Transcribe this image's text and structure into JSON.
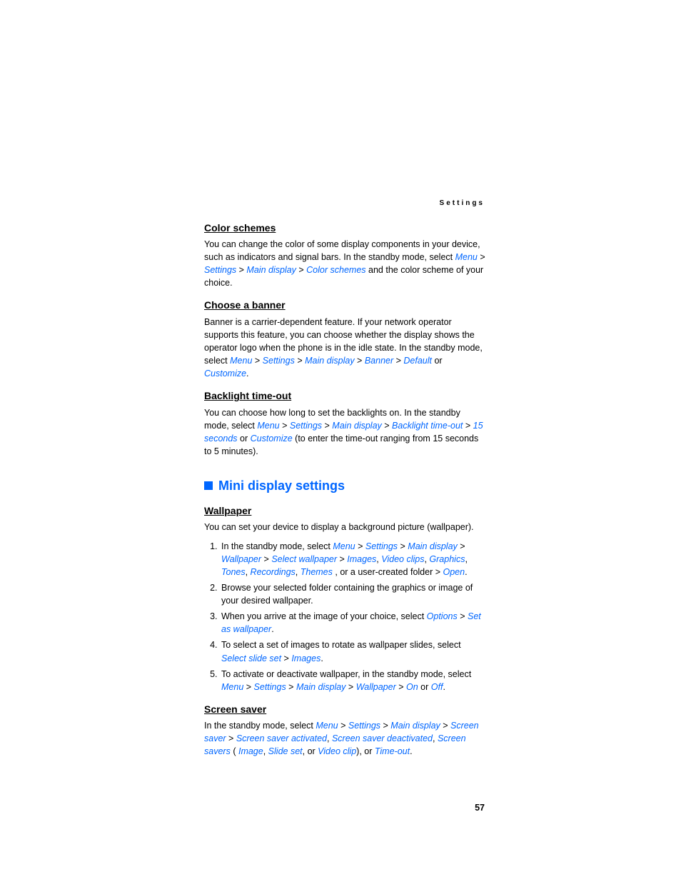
{
  "header": {
    "running": "Settings"
  },
  "page_number": "57",
  "sections": {
    "color_schemes": {
      "title": "Color schemes",
      "p1a": "You can change the color of some display components in your device, such as indicators and signal bars. In the standby mode, select ",
      "t1": "Menu",
      "t2": "Settings",
      "t3": "Main display",
      "t4": "Color schemes",
      "p1b": " and the color scheme of your choice."
    },
    "choose_banner": {
      "title": "Choose a banner",
      "p1a": "Banner is a carrier-dependent feature. If your network operator supports this feature, you can choose whether the display shows the operator logo when the phone is in the idle state. In the standby mode, select ",
      "t1": "Menu",
      "t2": "Settings",
      "t3": "Main display",
      "t4": "Banner",
      "t5": "Default",
      "t6": "Customize"
    },
    "backlight": {
      "title": "Backlight time-out",
      "p1a": "You can choose how long to set the backlights on. In the standby mode, select ",
      "t1": "Menu",
      "t2": "Settings",
      "t3": "Main display",
      "t4": "Backlight time-out",
      "t5": "15 seconds",
      "t6": "Customize",
      "p1b": " (to enter the time-out ranging from 15 seconds to 5 minutes)."
    },
    "mini_display": {
      "title": "Mini display settings"
    },
    "wallpaper": {
      "title": "Wallpaper",
      "p1": "You can set your device to display a background picture (wallpaper).",
      "li1a": "In the standby mode, select ",
      "li1t1": "Menu",
      "li1t2": "Settings",
      "li1t3": "Main display",
      "li1t4": "Wallpaper",
      "li1t5": "Select wallpaper",
      "li1t6": "Images",
      "li1t7": "Video clips",
      "li1t8": "Graphics",
      "li1t9": "Tones",
      "li1t10": "Recordings",
      "li1t11": "Themes",
      "li1b": ", or a user-created folder > ",
      "li1t12": "Open",
      "li2": "Browse your selected folder containing the graphics or image of your desired wallpaper.",
      "li3a": "When you arrive at the image of your choice, select ",
      "li3t1": "Options",
      "li3t2": "Set as wallpaper",
      "li4a": "To select a set of images to rotate as wallpaper slides, select ",
      "li4t1": "Select slide set",
      "li4t2": "Images",
      "li5a": "To activate or deactivate wallpaper, in the standby mode, select ",
      "li5t1": "Menu",
      "li5t2": "Settings",
      "li5t3": "Main display",
      "li5t4": "Wallpaper",
      "li5t5": "On",
      "li5t6": "Off"
    },
    "screen_saver": {
      "title": "Screen saver",
      "p1a": "In the standby mode, select ",
      "t1": "Menu",
      "t2": "Settings",
      "t3": "Main display",
      "t4": "Screen saver",
      "t5": "Screen saver activated",
      "t6": "Screen saver deactivated",
      "t7": "Screen savers",
      "t8": "Image",
      "t9": "Slide set",
      "t10": "Video clip",
      "t11": "Time-out"
    }
  }
}
